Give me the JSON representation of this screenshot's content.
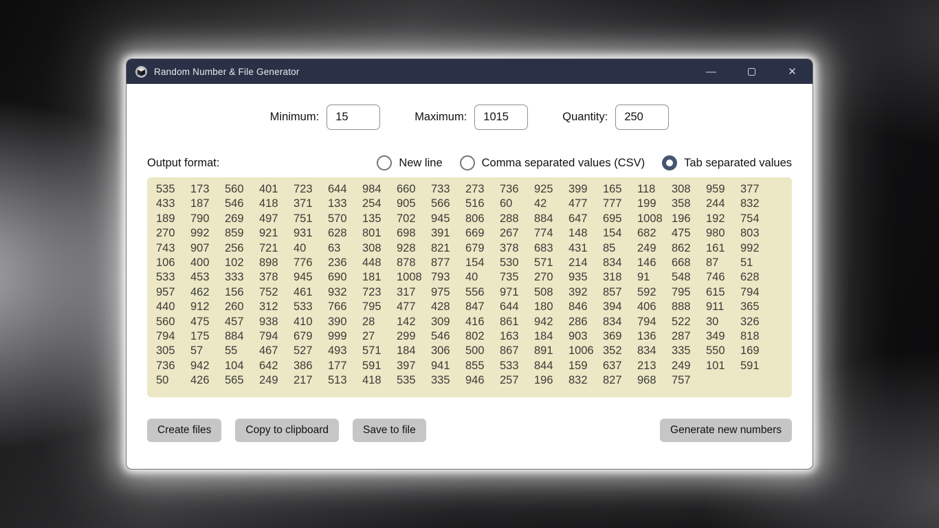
{
  "window": {
    "title": "Random Number & File Generator",
    "controls": {
      "minimize": "—",
      "close": "✕"
    }
  },
  "fields": [
    {
      "label": "Minimum:",
      "value": "15"
    },
    {
      "label": "Maximum:",
      "value": "1015"
    },
    {
      "label": "Quantity:",
      "value": "250"
    }
  ],
  "output_format": {
    "label": "Output format:",
    "options": [
      {
        "label": "New line",
        "selected": false
      },
      {
        "label": "Comma separated values (CSV)",
        "selected": false
      },
      {
        "label": "Tab separated values",
        "selected": true
      }
    ]
  },
  "numbers": {
    "rows": [
      [
        535,
        173,
        560,
        401,
        723,
        644,
        984,
        660,
        733,
        273,
        736,
        925,
        399,
        165,
        118,
        308,
        959,
        377
      ],
      [
        433,
        187,
        546,
        418,
        371,
        133,
        254,
        905,
        566,
        516,
        60,
        42,
        477,
        777,
        199,
        358,
        244,
        832
      ],
      [
        189,
        790,
        269,
        497,
        751,
        570,
        135,
        702,
        945,
        806,
        288,
        884,
        647,
        695,
        1008,
        196,
        192,
        754
      ],
      [
        270,
        992,
        859,
        921,
        931,
        628,
        801,
        698,
        391,
        669,
        267,
        774,
        148,
        154,
        682,
        475,
        980,
        803
      ],
      [
        743,
        907,
        256,
        721,
        40,
        63,
        308,
        928,
        821,
        679,
        378,
        683,
        431,
        85,
        249,
        862,
        161,
        992
      ],
      [
        106,
        400,
        102,
        898,
        776,
        236,
        448,
        878,
        877,
        154,
        530,
        571,
        214,
        834,
        146,
        668,
        87,
        51
      ],
      [
        533,
        453,
        333,
        378,
        945,
        690,
        181,
        1008,
        793,
        40,
        735,
        270,
        935,
        318,
        91,
        548,
        746,
        628
      ],
      [
        957,
        462,
        156,
        752,
        461,
        932,
        723,
        317,
        975,
        556,
        971,
        508,
        392,
        857,
        592,
        795,
        615,
        794
      ],
      [
        440,
        912,
        260,
        312,
        533,
        766,
        795,
        477,
        428,
        847,
        644,
        180,
        846,
        394,
        406,
        888,
        911,
        365
      ],
      [
        560,
        475,
        457,
        938,
        410,
        390,
        28,
        142,
        309,
        416,
        861,
        942,
        286,
        834,
        794,
        522,
        30,
        326
      ],
      [
        794,
        175,
        884,
        794,
        679,
        999,
        27,
        299,
        546,
        802,
        163,
        184,
        903,
        369,
        136,
        287,
        349,
        818
      ],
      [
        305,
        57,
        55,
        467,
        527,
        493,
        571,
        184,
        306,
        500,
        867,
        891,
        1006,
        352,
        834,
        335,
        550,
        169
      ],
      [
        736,
        942,
        104,
        642,
        386,
        177,
        591,
        397,
        941,
        855,
        533,
        844,
        159,
        637,
        213,
        249,
        101,
        591
      ],
      [
        50,
        426,
        565,
        249,
        217,
        513,
        418,
        535,
        335,
        946,
        257,
        196,
        832,
        827,
        968,
        757
      ]
    ]
  },
  "actions": [
    {
      "label": "Create files"
    },
    {
      "label": "Copy to clipboard"
    },
    {
      "label": "Save to file"
    },
    {
      "label": "Generate new numbers"
    }
  ],
  "colors": {
    "titlebar": "#2a3147",
    "panel_bg": "#ece7c5",
    "radio_accent": "#485571",
    "button_bg": "#c6c6c6",
    "window_bg": "#ffffff"
  }
}
